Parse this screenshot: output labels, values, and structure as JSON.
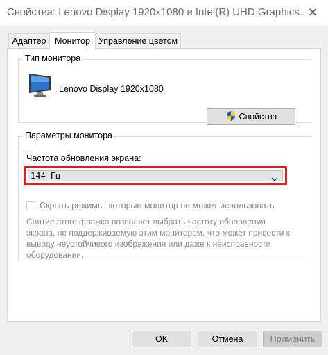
{
  "window": {
    "title": "Свойства: Lenovo Display 1920x1080 и Intel(R) UHD Graphics...",
    "close_glyph": "✕"
  },
  "tabs": [
    {
      "label": "Адаптер",
      "active": false
    },
    {
      "label": "Монитор",
      "active": true
    },
    {
      "label": "Управление цветом",
      "active": false
    }
  ],
  "monitor_type": {
    "group_title": "Тип монитора",
    "monitor_name": "Lenovo Display 1920x1080",
    "properties_label": "Свойства",
    "icon": "monitor-icon"
  },
  "monitor_settings": {
    "group_title": "Параметры монитора",
    "refresh_label": "Частота обновления экрана:",
    "refresh_value": "144 Гц",
    "hide_modes_label": "Скрыть режимы, которые монитор не может использовать",
    "hide_modes_checked": false,
    "description": "Снятие этого флажка позволяет выбрать частоту обновления экрана, не поддерживаемую этим монитором, что может привести к выводу неустойчивого изображения или даже к неисправности оборудования."
  },
  "buttons": {
    "ok": "OK",
    "cancel": "Отмена",
    "apply": "Применить"
  },
  "colors": {
    "highlight": "#e01e1e",
    "disabled_text": "#8a8a8a"
  }
}
